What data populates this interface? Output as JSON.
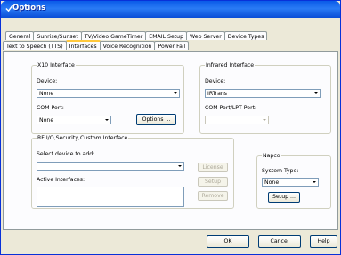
{
  "window": {
    "title": "Options"
  },
  "tabs_row1": [
    "General",
    "Sunrise/Sunset",
    "TV/Video GameTimer",
    "EMAIL Setup",
    "Web Server",
    "Device Types"
  ],
  "tabs_row2": [
    "Text to Speech (TTS)",
    "Interfaces",
    "Voice Recognition",
    "Power Fail"
  ],
  "active_tab": "Interfaces",
  "x10": {
    "title": "X10 Interface",
    "device_label": "Device:",
    "device_value": "None",
    "com_port_label": "COM Port:",
    "com_port_value": "None",
    "options_button": "Options ..."
  },
  "infrared": {
    "title": "Infrared Interface",
    "device_label": "Device:",
    "device_value": "IRTrans",
    "com_port_label": "COM Port/LPT Port:",
    "com_port_value": ""
  },
  "rf": {
    "title": "RF,I/O,Security,Custom Interface",
    "select_label": "Select device to add:",
    "select_value": "",
    "active_label": "Active Interfaces:",
    "license_button": "License",
    "setup_button": "Setup",
    "remove_button": "Remove"
  },
  "napco": {
    "title": "Napco",
    "system_type_label": "System Type:",
    "system_type_value": "None",
    "setup_button": "Setup ..."
  },
  "footer": {
    "ok": "OK",
    "cancel": "Cancel",
    "help": "Help"
  }
}
